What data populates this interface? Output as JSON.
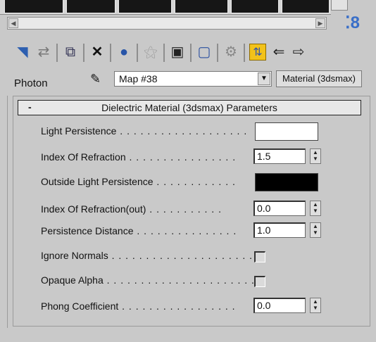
{
  "panel": {
    "section_label": "Photon",
    "map_name": "Map #38",
    "material_type_label": "Material (3dsmax)"
  },
  "toolbar": {
    "icons": [
      "get-material-icon",
      "put-to-scene-icon",
      "assign-to-selection-icon",
      "reset-map-icon",
      "make-unique-icon",
      "put-to-library-icon",
      "material-id-channel-icon",
      "show-map-in-viewport-icon",
      "show-end-result-icon",
      "go-to-parent-icon",
      "go-forward-to-sibling-icon",
      "pick-from-object-icon"
    ],
    "active_icon": "go-to-parent-icon",
    "accent_color": "#f2c21a"
  },
  "rollout": {
    "toggle_symbol": "-",
    "title": "Dielectric Material (3dsmax) Parameters",
    "params": {
      "light_persistence": {
        "label": "Light Persistence",
        "color": "#ffffff"
      },
      "ior": {
        "label": "Index Of Refraction",
        "value": "1.5"
      },
      "outside_light_persistence": {
        "label": "Outside Light Persistence",
        "color": "#000000"
      },
      "ior_out": {
        "label": "Index Of Refraction(out)",
        "value": "0.0"
      },
      "persistence_distance": {
        "label": "Persistence Distance",
        "value": "1.0"
      },
      "ignore_normals": {
        "label": "Ignore Normals",
        "checked": false
      },
      "opaque_alpha": {
        "label": "Opaque Alpha",
        "checked": false
      },
      "phong_coefficient": {
        "label": "Phong Coefficient",
        "value": "0.0"
      }
    }
  }
}
